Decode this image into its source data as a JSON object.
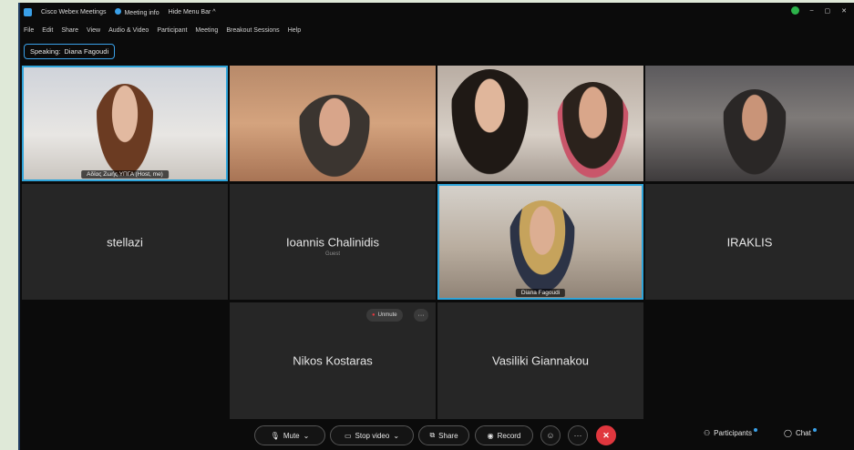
{
  "titlebar": {
    "app_title": "Cisco Webex Meetings",
    "meeting_info": "Meeting info",
    "hide_menu": "Hide Menu Bar ^",
    "minimize": "–",
    "restore": "▢",
    "close": "✕"
  },
  "menu": [
    "File",
    "Edit",
    "Share",
    "View",
    "Audio & Video",
    "Participant",
    "Meeting",
    "Breakout Sessions",
    "Help"
  ],
  "speaking": {
    "label": "Speaking:",
    "name": "Diana Fagoudi"
  },
  "tiles": {
    "t1_caption": "Aδίας Ζωής ΥΠΓΑ (Host, me)",
    "t6_name": "stellazi",
    "t7_name": "Ioannis Chalinidis",
    "t7_sub": "Guest",
    "t9_caption": "Diana Fagoudi",
    "t10_name": "IRAKLIS",
    "t12_name": "Nikos Kostaras",
    "t12_unmute": "Unmute",
    "t12_more": "···",
    "t13_name": "Vasiliki Giannakou"
  },
  "controls": {
    "mute": "Mute",
    "stop_video": "Stop video",
    "share": "Share",
    "record": "Record",
    "participants": "Participants",
    "chat": "Chat"
  },
  "colors": {
    "accent": "#2fa4d9",
    "end": "#e0373e",
    "status": "#2cb34a"
  }
}
